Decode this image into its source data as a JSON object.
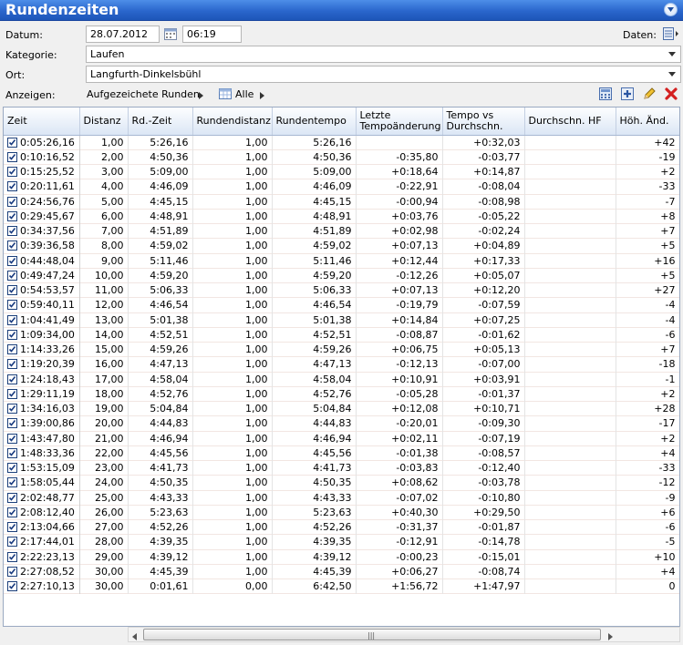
{
  "window": {
    "title": "Rundenzeiten"
  },
  "form": {
    "datum_label": "Datum:",
    "date": "28.07.2012",
    "time": "06:19",
    "daten_label": "Daten:",
    "kategorie_label": "Kategorie:",
    "kategorie": "Laufen",
    "ort_label": "Ort:",
    "ort": "Langfurth-Dinkelsbühl"
  },
  "toolbar": {
    "anzeigen_label": "Anzeigen:",
    "view_select": "Aufgezeichete Runden",
    "filter_select": "Alle"
  },
  "columns": [
    "Zeit",
    "Distanz",
    "Rd.-Zeit",
    "Rundendistanz",
    "Rundentempo",
    "Letzte Tempoänderung",
    "Tempo vs Durchschn.",
    "Durchschn. HF",
    "Höh. Änd."
  ],
  "rows": [
    [
      "0:05:26,16",
      "1,00",
      "5:26,16",
      "1,00",
      "5:26,16",
      "",
      "+0:32,03",
      "",
      "+42"
    ],
    [
      "0:10:16,52",
      "2,00",
      "4:50,36",
      "1,00",
      "4:50,36",
      "-0:35,80",
      "-0:03,77",
      "",
      "-19"
    ],
    [
      "0:15:25,52",
      "3,00",
      "5:09,00",
      "1,00",
      "5:09,00",
      "+0:18,64",
      "+0:14,87",
      "",
      "+2"
    ],
    [
      "0:20:11,61",
      "4,00",
      "4:46,09",
      "1,00",
      "4:46,09",
      "-0:22,91",
      "-0:08,04",
      "",
      "-33"
    ],
    [
      "0:24:56,76",
      "5,00",
      "4:45,15",
      "1,00",
      "4:45,15",
      "-0:00,94",
      "-0:08,98",
      "",
      "-7"
    ],
    [
      "0:29:45,67",
      "6,00",
      "4:48,91",
      "1,00",
      "4:48,91",
      "+0:03,76",
      "-0:05,22",
      "",
      "+8"
    ],
    [
      "0:34:37,56",
      "7,00",
      "4:51,89",
      "1,00",
      "4:51,89",
      "+0:02,98",
      "-0:02,24",
      "",
      "+7"
    ],
    [
      "0:39:36,58",
      "8,00",
      "4:59,02",
      "1,00",
      "4:59,02",
      "+0:07,13",
      "+0:04,89",
      "",
      "+5"
    ],
    [
      "0:44:48,04",
      "9,00",
      "5:11,46",
      "1,00",
      "5:11,46",
      "+0:12,44",
      "+0:17,33",
      "",
      "+16"
    ],
    [
      "0:49:47,24",
      "10,00",
      "4:59,20",
      "1,00",
      "4:59,20",
      "-0:12,26",
      "+0:05,07",
      "",
      "+5"
    ],
    [
      "0:54:53,57",
      "11,00",
      "5:06,33",
      "1,00",
      "5:06,33",
      "+0:07,13",
      "+0:12,20",
      "",
      "+27"
    ],
    [
      "0:59:40,11",
      "12,00",
      "4:46,54",
      "1,00",
      "4:46,54",
      "-0:19,79",
      "-0:07,59",
      "",
      "-4"
    ],
    [
      "1:04:41,49",
      "13,00",
      "5:01,38",
      "1,00",
      "5:01,38",
      "+0:14,84",
      "+0:07,25",
      "",
      "-4"
    ],
    [
      "1:09:34,00",
      "14,00",
      "4:52,51",
      "1,00",
      "4:52,51",
      "-0:08,87",
      "-0:01,62",
      "",
      "-6"
    ],
    [
      "1:14:33,26",
      "15,00",
      "4:59,26",
      "1,00",
      "4:59,26",
      "+0:06,75",
      "+0:05,13",
      "",
      "+7"
    ],
    [
      "1:19:20,39",
      "16,00",
      "4:47,13",
      "1,00",
      "4:47,13",
      "-0:12,13",
      "-0:07,00",
      "",
      "-18"
    ],
    [
      "1:24:18,43",
      "17,00",
      "4:58,04",
      "1,00",
      "4:58,04",
      "+0:10,91",
      "+0:03,91",
      "",
      "-1"
    ],
    [
      "1:29:11,19",
      "18,00",
      "4:52,76",
      "1,00",
      "4:52,76",
      "-0:05,28",
      "-0:01,37",
      "",
      "+2"
    ],
    [
      "1:34:16,03",
      "19,00",
      "5:04,84",
      "1,00",
      "5:04,84",
      "+0:12,08",
      "+0:10,71",
      "",
      "+28"
    ],
    [
      "1:39:00,86",
      "20,00",
      "4:44,83",
      "1,00",
      "4:44,83",
      "-0:20,01",
      "-0:09,30",
      "",
      "-17"
    ],
    [
      "1:43:47,80",
      "21,00",
      "4:46,94",
      "1,00",
      "4:46,94",
      "+0:02,11",
      "-0:07,19",
      "",
      "+2"
    ],
    [
      "1:48:33,36",
      "22,00",
      "4:45,56",
      "1,00",
      "4:45,56",
      "-0:01,38",
      "-0:08,57",
      "",
      "+4"
    ],
    [
      "1:53:15,09",
      "23,00",
      "4:41,73",
      "1,00",
      "4:41,73",
      "-0:03,83",
      "-0:12,40",
      "",
      "-33"
    ],
    [
      "1:58:05,44",
      "24,00",
      "4:50,35",
      "1,00",
      "4:50,35",
      "+0:08,62",
      "-0:03,78",
      "",
      "-12"
    ],
    [
      "2:02:48,77",
      "25,00",
      "4:43,33",
      "1,00",
      "4:43,33",
      "-0:07,02",
      "-0:10,80",
      "",
      "-9"
    ],
    [
      "2:08:12,40",
      "26,00",
      "5:23,63",
      "1,00",
      "5:23,63",
      "+0:40,30",
      "+0:29,50",
      "",
      "+6"
    ],
    [
      "2:13:04,66",
      "27,00",
      "4:52,26",
      "1,00",
      "4:52,26",
      "-0:31,37",
      "-0:01,87",
      "",
      "-6"
    ],
    [
      "2:17:44,01",
      "28,00",
      "4:39,35",
      "1,00",
      "4:39,35",
      "-0:12,91",
      "-0:14,78",
      "",
      "-5"
    ],
    [
      "2:22:23,13",
      "29,00",
      "4:39,12",
      "1,00",
      "4:39,12",
      "-0:00,23",
      "-0:15,01",
      "",
      "+10"
    ],
    [
      "2:27:08,52",
      "30,00",
      "4:45,39",
      "1,00",
      "4:45,39",
      "+0:06,27",
      "-0:08,74",
      "",
      "+4"
    ],
    [
      "2:27:10,13",
      "30,00",
      "0:01,61",
      "0,00",
      "6:42,50",
      "+1:56,72",
      "+1:47,97",
      "",
      "0"
    ]
  ]
}
